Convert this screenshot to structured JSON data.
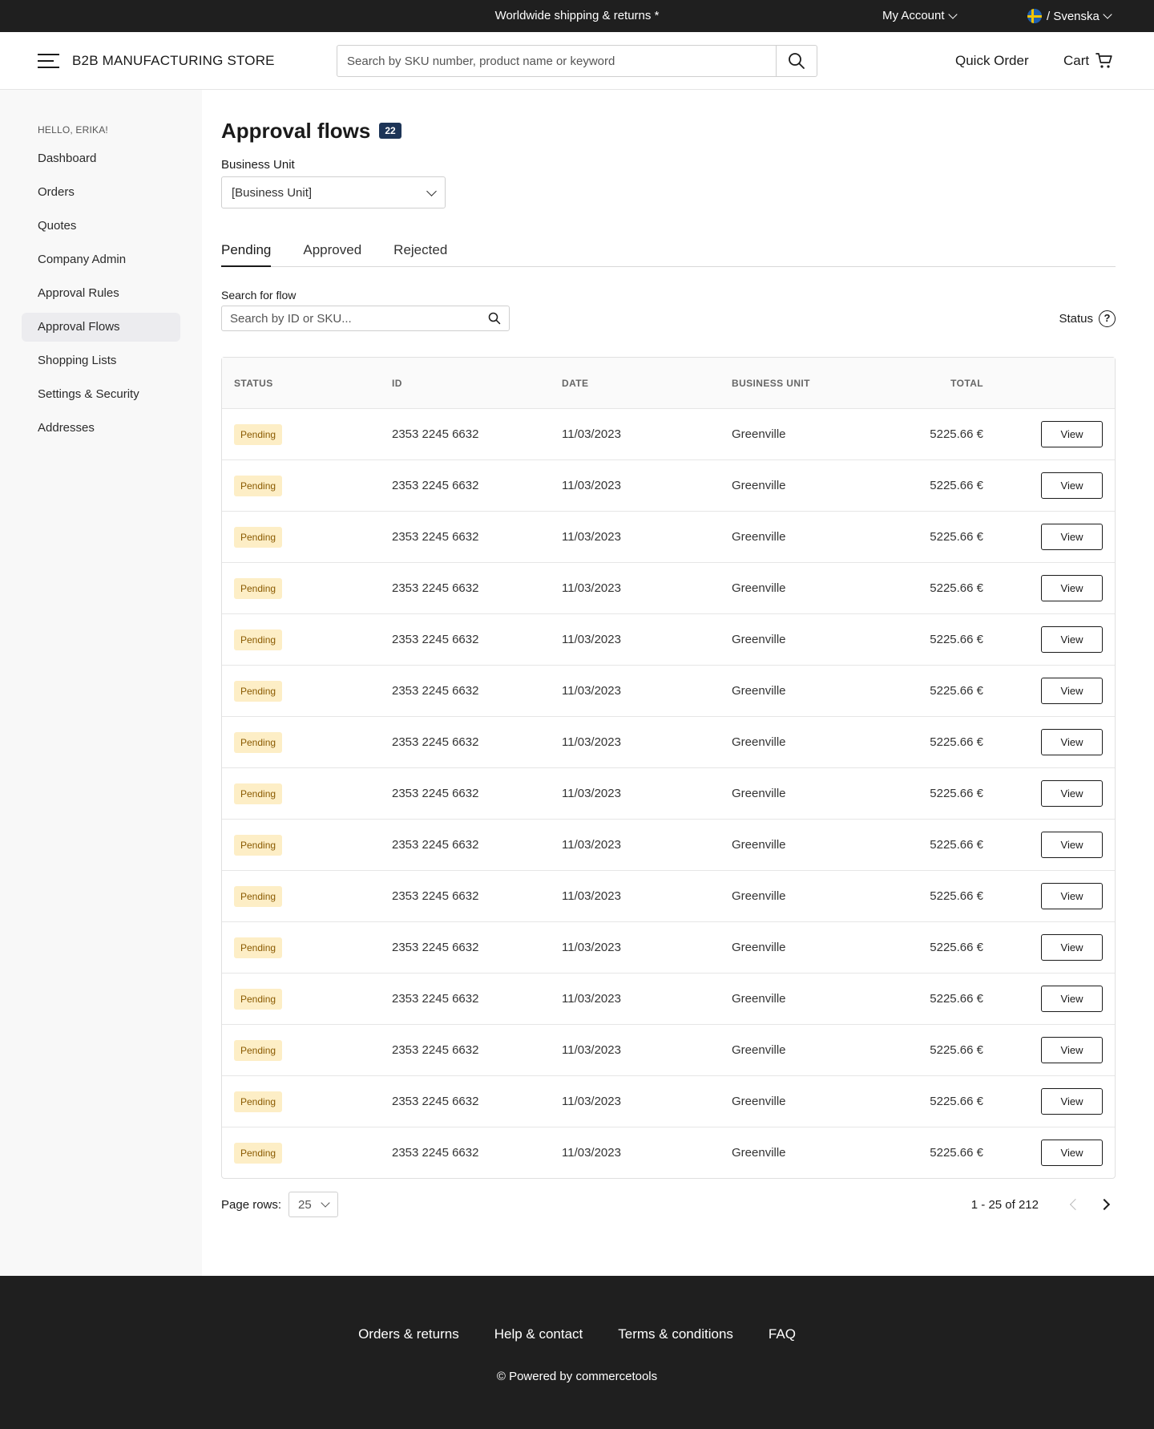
{
  "topbar": {
    "shipping": "Worldwide shipping & returns *",
    "account": "My Account",
    "language": "/ Svenska"
  },
  "header": {
    "logo": "B2B MANUFACTURING STORE",
    "search_placeholder": "Search by SKU number, product name or keyword",
    "quick_order": "Quick Order",
    "cart": "Cart"
  },
  "sidebar": {
    "greeting": "HELLO, ERIKA!",
    "items": [
      {
        "label": "Dashboard"
      },
      {
        "label": "Orders"
      },
      {
        "label": "Quotes"
      },
      {
        "label": "Company Admin"
      },
      {
        "label": "Approval Rules"
      },
      {
        "label": "Approval Flows"
      },
      {
        "label": "Shopping Lists"
      },
      {
        "label": "Settings & Security"
      },
      {
        "label": "Addresses"
      }
    ],
    "active": "Approval Flows"
  },
  "main": {
    "title": "Approval flows",
    "count": "22",
    "business_unit_label": "Business Unit",
    "business_unit_value": "[Business Unit]",
    "tabs": [
      {
        "label": "Pending"
      },
      {
        "label": "Approved"
      },
      {
        "label": "Rejected"
      }
    ],
    "active_tab": "Pending",
    "search_label": "Search for flow",
    "search_placeholder": "Search by ID or SKU...",
    "status_label": "Status",
    "help_glyph": "?"
  },
  "table": {
    "headers": {
      "status": "STATUS",
      "id": "ID",
      "date": "DATE",
      "business_unit": "BUSINESS UNIT",
      "total": "TOTAL"
    },
    "rows": [
      {
        "status": "Pending",
        "id": "2353 2245 6632",
        "date": "11/03/2023",
        "business_unit": "Greenville",
        "total": "5225.66 €",
        "action": "View"
      },
      {
        "status": "Pending",
        "id": "2353 2245 6632",
        "date": "11/03/2023",
        "business_unit": "Greenville",
        "total": "5225.66 €",
        "action": "View"
      },
      {
        "status": "Pending",
        "id": "2353 2245 6632",
        "date": "11/03/2023",
        "business_unit": "Greenville",
        "total": "5225.66 €",
        "action": "View"
      },
      {
        "status": "Pending",
        "id": "2353 2245 6632",
        "date": "11/03/2023",
        "business_unit": "Greenville",
        "total": "5225.66 €",
        "action": "View"
      },
      {
        "status": "Pending",
        "id": "2353 2245 6632",
        "date": "11/03/2023",
        "business_unit": "Greenville",
        "total": "5225.66 €",
        "action": "View"
      },
      {
        "status": "Pending",
        "id": "2353 2245 6632",
        "date": "11/03/2023",
        "business_unit": "Greenville",
        "total": "5225.66 €",
        "action": "View"
      },
      {
        "status": "Pending",
        "id": "2353 2245 6632",
        "date": "11/03/2023",
        "business_unit": "Greenville",
        "total": "5225.66 €",
        "action": "View"
      },
      {
        "status": "Pending",
        "id": "2353 2245 6632",
        "date": "11/03/2023",
        "business_unit": "Greenville",
        "total": "5225.66 €",
        "action": "View"
      },
      {
        "status": "Pending",
        "id": "2353 2245 6632",
        "date": "11/03/2023",
        "business_unit": "Greenville",
        "total": "5225.66 €",
        "action": "View"
      },
      {
        "status": "Pending",
        "id": "2353 2245 6632",
        "date": "11/03/2023",
        "business_unit": "Greenville",
        "total": "5225.66 €",
        "action": "View"
      },
      {
        "status": "Pending",
        "id": "2353 2245 6632",
        "date": "11/03/2023",
        "business_unit": "Greenville",
        "total": "5225.66 €",
        "action": "View"
      },
      {
        "status": "Pending",
        "id": "2353 2245 6632",
        "date": "11/03/2023",
        "business_unit": "Greenville",
        "total": "5225.66 €",
        "action": "View"
      },
      {
        "status": "Pending",
        "id": "2353 2245 6632",
        "date": "11/03/2023",
        "business_unit": "Greenville",
        "total": "5225.66 €",
        "action": "View"
      },
      {
        "status": "Pending",
        "id": "2353 2245 6632",
        "date": "11/03/2023",
        "business_unit": "Greenville",
        "total": "5225.66 €",
        "action": "View"
      },
      {
        "status": "Pending",
        "id": "2353 2245 6632",
        "date": "11/03/2023",
        "business_unit": "Greenville",
        "total": "5225.66 €",
        "action": "View"
      }
    ]
  },
  "pagination": {
    "rows_label": "Page rows:",
    "rows_value": "25",
    "range": "1 - 25 of 212"
  },
  "footer": {
    "links": [
      {
        "label": "Orders & returns"
      },
      {
        "label": "Help & contact"
      },
      {
        "label": "Terms & conditions"
      },
      {
        "label": "FAQ"
      }
    ],
    "powered": "© Powered by commercetools"
  },
  "colors": {
    "dark_bar": "#1f1f1f",
    "badge": "#1d3557",
    "pending_bg": "#fdeec6",
    "pending_text": "#8a5a00",
    "sidebar_bg": "#f8f8f8"
  },
  "icons": [
    "menu-icon",
    "search-icon",
    "cart-icon",
    "chevron-down-icon",
    "flag-icon",
    "help-icon",
    "chevron-left-icon",
    "chevron-right-icon"
  ]
}
